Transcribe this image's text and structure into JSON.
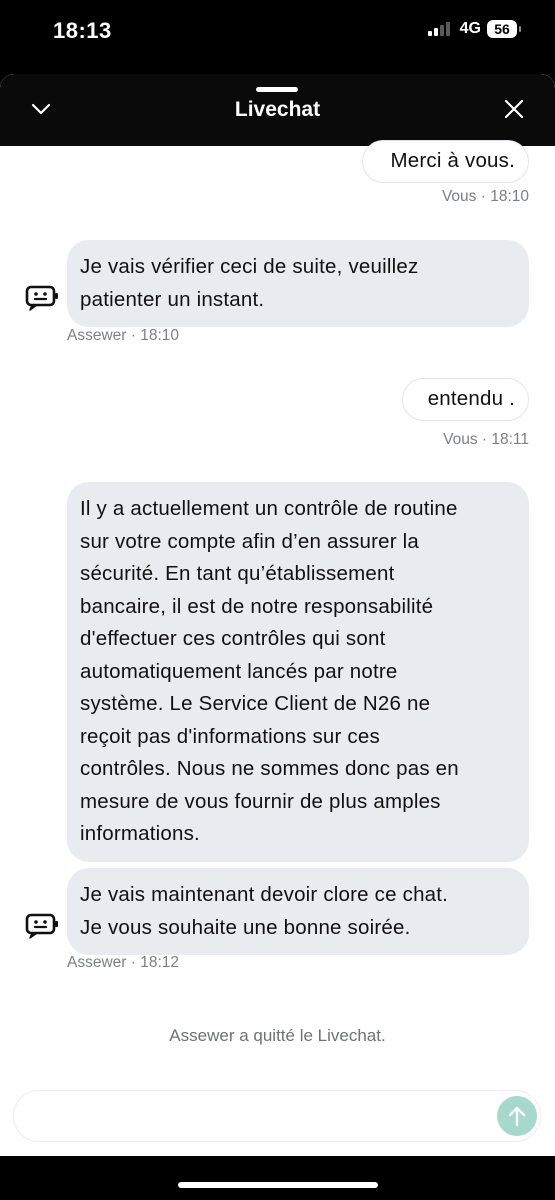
{
  "status_bar": {
    "time": "18:13",
    "network": "4G",
    "battery": "56"
  },
  "header": {
    "title": "Livechat",
    "collapse_icon": "chevron-down-icon",
    "close_icon": "close-icon"
  },
  "messages": [
    {
      "sender": "user",
      "text": "Merci à vous.",
      "meta": "Vous · 18:10"
    },
    {
      "sender": "agent",
      "lines": [
        "Je vais vérifier ceci de suite, veuillez",
        "patienter un instant."
      ],
      "meta": "Assewer · 18:10"
    },
    {
      "sender": "user",
      "text": "entendu .",
      "meta": "Vous · 18:11"
    },
    {
      "sender": "agent",
      "lines": [
        "Il y a actuellement un contrôle de routine",
        "sur votre compte afin d’en assurer la",
        "sécurité. En tant qu’établissement",
        "bancaire, il est de notre responsabilité",
        "d'effectuer ces contrôles qui sont",
        "automatiquement lancés par notre",
        "système. Le Service Client de N26 ne",
        "reçoit pas d'informations sur ces",
        "contrôles. Nous ne sommes donc pas en",
        "mesure de vous fournir de plus amples",
        "informations."
      ]
    },
    {
      "sender": "agent",
      "lines": [
        "Je vais maintenant devoir clore ce chat.",
        "Je vous souhaite une bonne soirée."
      ],
      "meta": "Assewer · 18:12"
    }
  ],
  "system_note": "Assewer a quitté le Livechat.",
  "composer": {
    "placeholder": "",
    "send_icon": "arrow-up-icon"
  },
  "colors": {
    "accent": "#a6d8cc",
    "agent_bubble": "#e8ebef",
    "header": "#0a0a0a"
  }
}
